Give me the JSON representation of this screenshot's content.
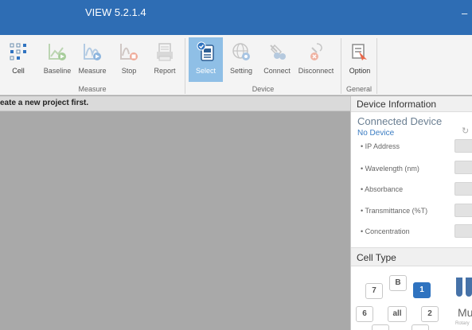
{
  "window": {
    "title": "VIEW 5.2.1.4",
    "minimize_glyph": "–"
  },
  "ribbon": {
    "buttons": [
      {
        "label": "Cell",
        "icon": "cell-grid-icon"
      },
      {
        "label": "Baseline",
        "icon": "baseline-chart-icon"
      },
      {
        "label": "Measure",
        "icon": "measure-chart-icon"
      },
      {
        "label": "Stop",
        "icon": "stop-icon"
      },
      {
        "label": "Report",
        "icon": "report-icon"
      },
      {
        "label": "Select",
        "icon": "select-device-icon"
      },
      {
        "label": "Setting",
        "icon": "globe-settings-icon"
      },
      {
        "label": "Connect",
        "icon": "connect-icon"
      },
      {
        "label": "Disconnect",
        "icon": "disconnect-icon"
      },
      {
        "label": "Option",
        "icon": "option-icon"
      }
    ],
    "groups": {
      "measure": "Measure",
      "device": "Device",
      "general": "General"
    }
  },
  "status": {
    "message": "eate a new project first."
  },
  "device_panel": {
    "header": "Device Information",
    "connected_title": "Connected Device",
    "device_name": "No Device",
    "refresh_glyph": "↻",
    "fields": [
      "• IP Address",
      "• Wavelength (nm)",
      "• Absorbance",
      "• Transmittance (%T)",
      "• Concentration"
    ]
  },
  "cell_type": {
    "header": "Cell Type",
    "buttons": [
      "B",
      "7",
      "1",
      "6",
      "all",
      "2"
    ],
    "selected": "1",
    "multi_label": "Mul",
    "rotary_label": "Rotary"
  },
  "colors": {
    "titlebar": "#2e6db4",
    "selected_tool": "#8fbfe6",
    "accent_blue": "#2f73c0",
    "warning_orange": "#e8674a",
    "tool_green": "#6aab5a"
  }
}
